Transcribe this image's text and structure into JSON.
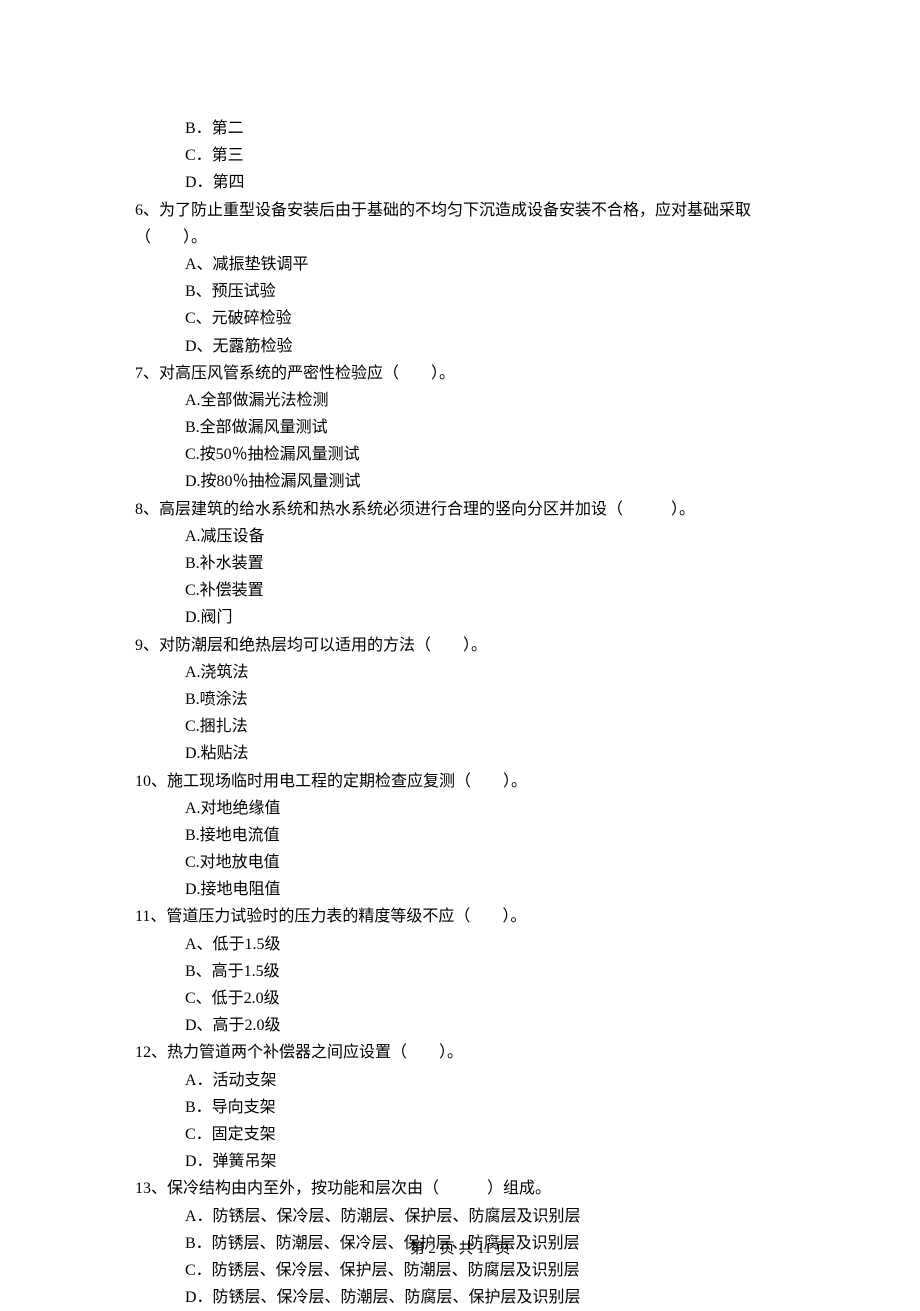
{
  "q5_options_tail": [
    {
      "label": "B．第二"
    },
    {
      "label": "C．第三"
    },
    {
      "label": "D．第四"
    }
  ],
  "questions": [
    {
      "stem": "6、为了防止重型设备安装后由于基础的不均匀下沉造成设备安装不合格，应对基础采取",
      "stem2": "（　　）。",
      "options": [
        "A、减振垫铁调平",
        "B、预压试验",
        "C、元破碎检验",
        "D、无露筋检验"
      ]
    },
    {
      "stem": "7、对高压风管系统的严密性检验应（　　）。",
      "options": [
        "A.全部做漏光法检测",
        "B.全部做漏风量测试",
        "C.按50％抽检漏风量测试",
        "D.按80％抽检漏风量测试"
      ]
    },
    {
      "stem": "8、高层建筑的给水系统和热水系统必须进行合理的竖向分区并加设（　　　）。",
      "options": [
        "A.减压设备",
        "B.补水装置",
        "C.补偿装置",
        "D.阀门"
      ]
    },
    {
      "stem": "9、对防潮层和绝热层均可以适用的方法（　　）。",
      "options": [
        "A.浇筑法",
        "B.喷涂法",
        "C.捆扎法",
        "D.粘贴法"
      ]
    },
    {
      "stem": "10、施工现场临时用电工程的定期检查应复测（　　）。",
      "options": [
        "A.对地绝缘值",
        "B.接地电流值",
        "C.对地放电值",
        "D.接地电阻值"
      ]
    },
    {
      "stem": "11、管道压力试验时的压力表的精度等级不应（　　）。",
      "options": [
        "A、低于1.5级",
        "B、高于1.5级",
        "C、低于2.0级",
        "D、高于2.0级"
      ]
    },
    {
      "stem": "12、热力管道两个补偿器之间应设置（　　）。",
      "options": [
        "A．活动支架",
        "B．导向支架",
        "C．固定支架",
        "D．弹簧吊架"
      ]
    },
    {
      "stem": "13、保冷结构由内至外，按功能和层次由（　　　）组成。",
      "options": [
        "A．防锈层、保冷层、防潮层、保护层、防腐层及识别层",
        "B．防锈层、防潮层、保冷层、保护层、防腐层及识别层",
        "C．防锈层、保冷层、保护层、防潮层、防腐层及识别层",
        "D．防锈层、保冷层、防潮层、防腐层、保护层及识别层"
      ]
    }
  ],
  "footer": "第 2 页 共 11 页"
}
